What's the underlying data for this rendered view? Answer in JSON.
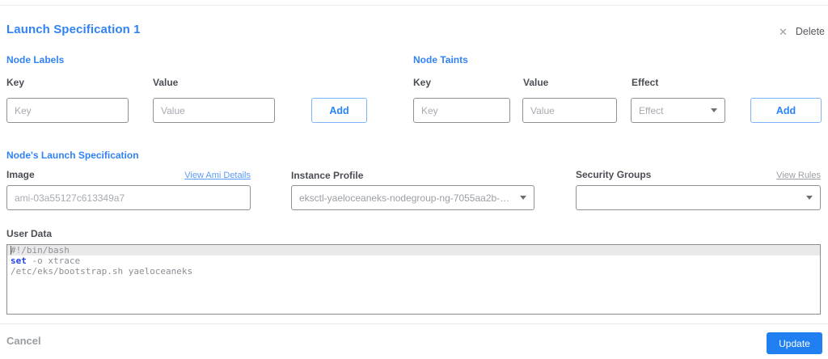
{
  "header": {
    "title": "Launch Specification 1",
    "delete_label": "Delete",
    "close_icon": "✕"
  },
  "node_labels": {
    "section_title": "Node Labels",
    "key_label": "Key",
    "key_placeholder": "Key",
    "value_label": "Value",
    "value_placeholder": "Value",
    "add_label": "Add"
  },
  "node_taints": {
    "section_title": "Node Taints",
    "key_label": "Key",
    "key_placeholder": "Key",
    "value_label": "Value",
    "value_placeholder": "Value",
    "effect_label": "Effect",
    "effect_placeholder": "Effect",
    "add_label": "Add"
  },
  "launch_spec": {
    "section_title": "Node's Launch Specification",
    "image_label": "Image",
    "view_ami_link": "View Ami Details",
    "image_placeholder": "ami-03a55127c613349a7",
    "instance_profile_label": "Instance Profile",
    "instance_profile_value": "eksctl-yaeloceaneks-nodegroup-ng-7055aa2b-NodeInstanceProfile-...",
    "security_groups_label": "Security Groups",
    "security_groups_value": "",
    "view_rules_link": "View Rules"
  },
  "user_data": {
    "label": "User Data",
    "lines": [
      {
        "highlight": true,
        "tokens": [
          {
            "c": "plain",
            "t": "#!/bin/bash"
          }
        ]
      },
      {
        "highlight": false,
        "tokens": [
          {
            "c": "keyword",
            "t": "set"
          },
          {
            "c": "plain",
            "t": " -o xtrace"
          }
        ]
      },
      {
        "highlight": false,
        "tokens": [
          {
            "c": "plain",
            "t": "/etc/eks/bootstrap.sh yaeloceaneks"
          }
        ]
      }
    ]
  },
  "footer": {
    "cancel_label": "Cancel",
    "update_label": "Update"
  },
  "colors": {
    "accent_blue": "#3183f5",
    "add_button_blue": "#2684ff",
    "update_button_blue": "#2080f2",
    "link_blue": "#5b9bf8",
    "keyword_blue": "#2443e0",
    "label_gray": "#4a4e54",
    "muted_gray": "#9a9ea3"
  }
}
